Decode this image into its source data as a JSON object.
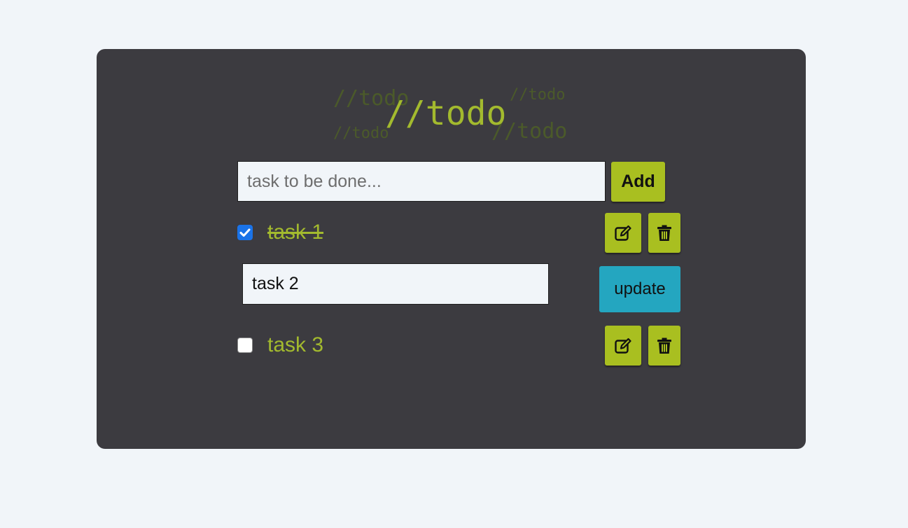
{
  "header": {
    "title": "//todo",
    "echo_text": "//todo"
  },
  "add_form": {
    "placeholder": "task to be done...",
    "value": "",
    "add_label": "Add"
  },
  "tasks": [
    {
      "label": "task 1",
      "completed": true,
      "editing": false
    },
    {
      "label": "task 2",
      "completed": false,
      "editing": true,
      "update_label": "update"
    },
    {
      "label": "task 3",
      "completed": false,
      "editing": false
    }
  ],
  "icons": {
    "edit": "edit-icon",
    "delete": "trash-icon",
    "check": "checkmark-icon"
  },
  "colors": {
    "page_bg": "#f1f5f9",
    "card_bg": "#3c3b40",
    "accent": "#a9bf20",
    "text_accent": "#a3ba2e",
    "update_button": "#24a6c0",
    "checkbox_checked": "#1a73e8"
  }
}
